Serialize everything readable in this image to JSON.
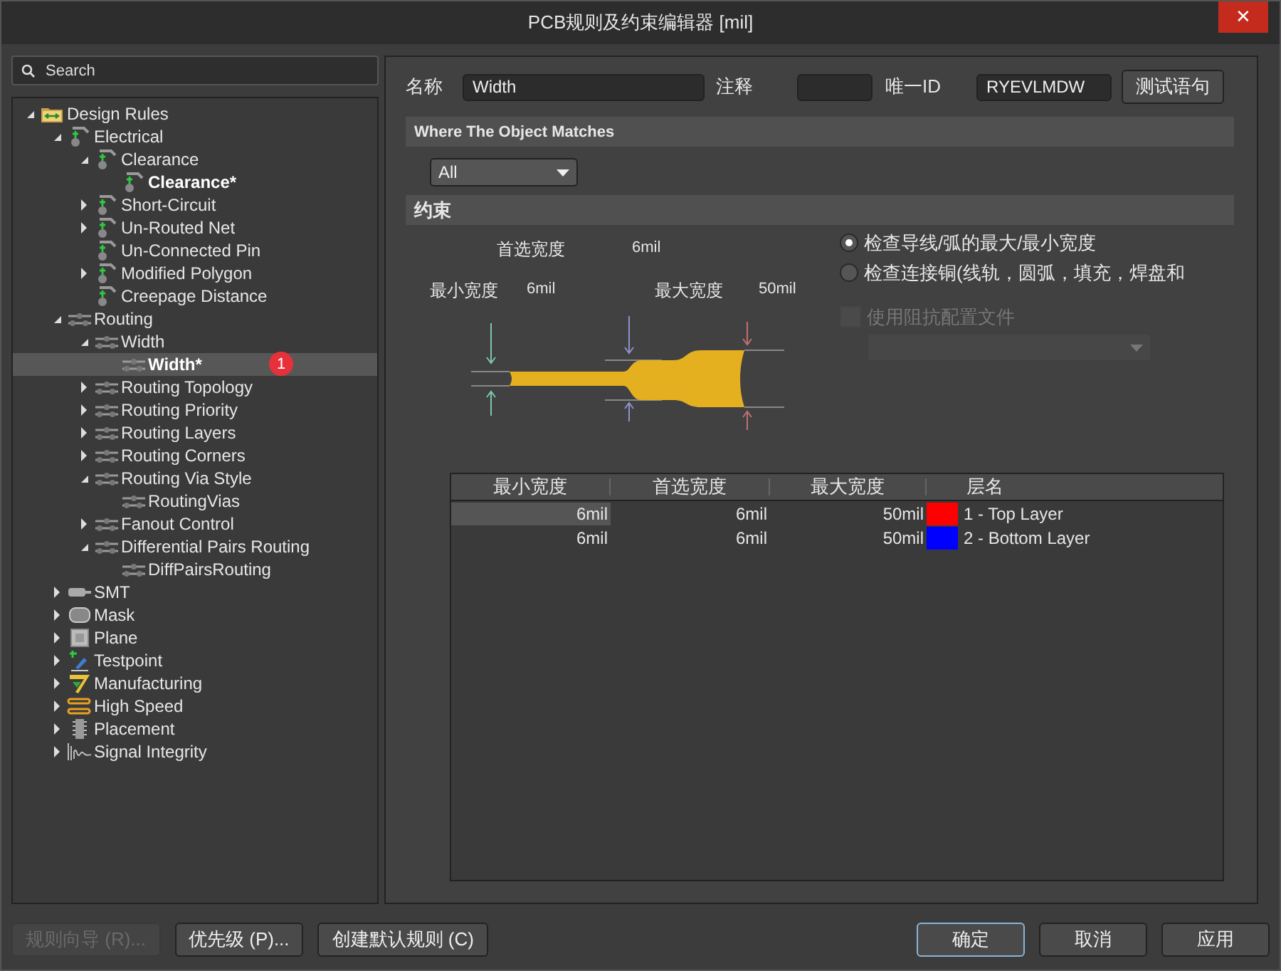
{
  "window": {
    "title": "PCB规则及约束编辑器 [mil]",
    "close": "✕"
  },
  "search": {
    "placeholder": "Search"
  },
  "tree": [
    {
      "label": "Design Rules",
      "kind": "folder",
      "expanded": true,
      "children": [
        {
          "label": "Electrical",
          "kind": "electrical",
          "expanded": true,
          "children": [
            {
              "label": "Clearance",
              "kind": "electrical",
              "expanded": true,
              "children": [
                {
                  "label": "Clearance*",
                  "kind": "electrical",
                  "rule": true,
                  "selected": false
                }
              ]
            },
            {
              "label": "Short-Circuit",
              "kind": "electrical",
              "expanded": false
            },
            {
              "label": "Un-Routed Net",
              "kind": "electrical",
              "expanded": false
            },
            {
              "label": "Un-Connected Pin",
              "kind": "electrical"
            },
            {
              "label": "Modified Polygon",
              "kind": "electrical",
              "expanded": false
            },
            {
              "label": "Creepage Distance",
              "kind": "electrical"
            }
          ]
        },
        {
          "label": "Routing",
          "kind": "routing",
          "expanded": true,
          "children": [
            {
              "label": "Width",
              "kind": "routing",
              "expanded": true,
              "children": [
                {
                  "label": "Width*",
                  "kind": "routing",
                  "rule": true,
                  "selected": true,
                  "badge": "1"
                }
              ]
            },
            {
              "label": "Routing Topology",
              "kind": "routing",
              "expanded": false
            },
            {
              "label": "Routing Priority",
              "kind": "routing",
              "expanded": false
            },
            {
              "label": "Routing Layers",
              "kind": "routing",
              "expanded": false
            },
            {
              "label": "Routing Corners",
              "kind": "routing",
              "expanded": false
            },
            {
              "label": "Routing Via Style",
              "kind": "routing",
              "expanded": true,
              "children": [
                {
                  "label": "RoutingVias",
                  "kind": "routing",
                  "rule": false,
                  "selected": false
                }
              ]
            },
            {
              "label": "Fanout Control",
              "kind": "routing",
              "expanded": false
            },
            {
              "label": "Differential Pairs Routing",
              "kind": "routing",
              "expanded": true,
              "children": [
                {
                  "label": "DiffPairsRouting",
                  "kind": "routing",
                  "rule": false,
                  "selected": false
                }
              ]
            }
          ]
        },
        {
          "label": "SMT",
          "kind": "smt",
          "expanded": false
        },
        {
          "label": "Mask",
          "kind": "mask",
          "expanded": false
        },
        {
          "label": "Plane",
          "kind": "plane",
          "expanded": false
        },
        {
          "label": "Testpoint",
          "kind": "testpoint",
          "expanded": false
        },
        {
          "label": "Manufacturing",
          "kind": "manufacturing",
          "expanded": false
        },
        {
          "label": "High Speed",
          "kind": "highspeed",
          "expanded": false
        },
        {
          "label": "Placement",
          "kind": "placement",
          "expanded": false
        },
        {
          "label": "Signal Integrity",
          "kind": "signal",
          "expanded": false
        }
      ]
    }
  ],
  "rule": {
    "name_label": "名称",
    "name": "Width",
    "comment_label": "注释",
    "id_label": "唯一ID",
    "id": "RYEVLMDW",
    "test_button": "测试语句"
  },
  "where": {
    "heading": "Where The Object Matches",
    "scope": "All"
  },
  "constraints": {
    "heading": "约束",
    "preferred_label": "首选宽度",
    "preferred": "6mil",
    "min_label": "最小宽度",
    "min": "6mil",
    "max_label": "最大宽度",
    "max": "50mil",
    "options": [
      {
        "label": "检查导线/弧的最大/最小宽度",
        "selected": true
      },
      {
        "label": "检查连接铜(线轨，圆弧，填充，焊盘和",
        "selected": false
      }
    ],
    "impedance": {
      "label": "使用阻抗配置文件",
      "checked": false,
      "disabled": true
    }
  },
  "table": {
    "columns": [
      "最小宽度",
      "首选宽度",
      "最大宽度",
      "层名"
    ],
    "rows": [
      {
        "min": "6mil",
        "preferred": "6mil",
        "max": "50mil",
        "color": "#ff0000",
        "layer": "1 - Top Layer",
        "selected": true
      },
      {
        "min": "6mil",
        "preferred": "6mil",
        "max": "50mil",
        "color": "#0000ff",
        "layer": "2 - Bottom Layer",
        "selected": false
      }
    ]
  },
  "buttons": [
    {
      "label": "规则向导 (R)...",
      "disabled": true,
      "default": false
    },
    {
      "label": "优先级 (P)...",
      "disabled": false,
      "default": false
    },
    {
      "label": "创建默认规则 (C)",
      "disabled": false,
      "default": false
    },
    {
      "label": "确定",
      "disabled": false,
      "default": true
    },
    {
      "label": "取消",
      "disabled": false,
      "default": false
    },
    {
      "label": "应用",
      "disabled": false,
      "default": false
    }
  ]
}
